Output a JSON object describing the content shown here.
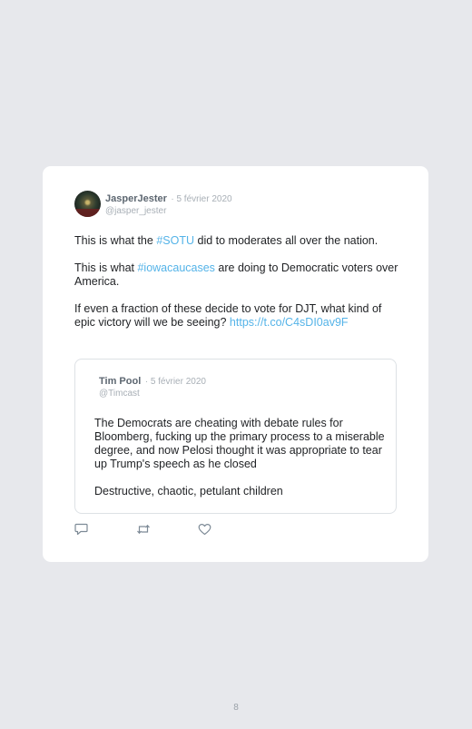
{
  "tweet": {
    "display_name": "JasperJester",
    "date": "5 février 2020",
    "handle": "@jasper_jester",
    "p1_a": "This is what the ",
    "p1_tag": "#SOTU",
    "p1_b": " did to moderates all over the nation.",
    "p2_a": "This is what ",
    "p2_tag": "#iowacaucases",
    "p2_b": " are doing to Democratic voters over America.",
    "p3_a": "If even a fraction of these decide to vote for DJT, what kind of epic victory will we be seeing? ",
    "p3_link": "https://t.co/C4sDI0av9F"
  },
  "quoted": {
    "display_name": "Tim Pool",
    "date": "5 février 2020",
    "handle": "@Timcast",
    "p1": "The Democrats are cheating with debate rules for Bloomberg, fucking up the primary process to a miserable degree, and now Pelosi thought it was appropriate to tear up Trump's speech as he closed",
    "p2": "Destructive, chaotic, petulant children"
  },
  "actions": [
    "reply-icon",
    "retweet-icon",
    "like-icon"
  ],
  "page": {
    "number": "8"
  },
  "colors": {
    "link": "#54b3e8",
    "background": "#e7e8ec",
    "card": "#ffffff"
  }
}
